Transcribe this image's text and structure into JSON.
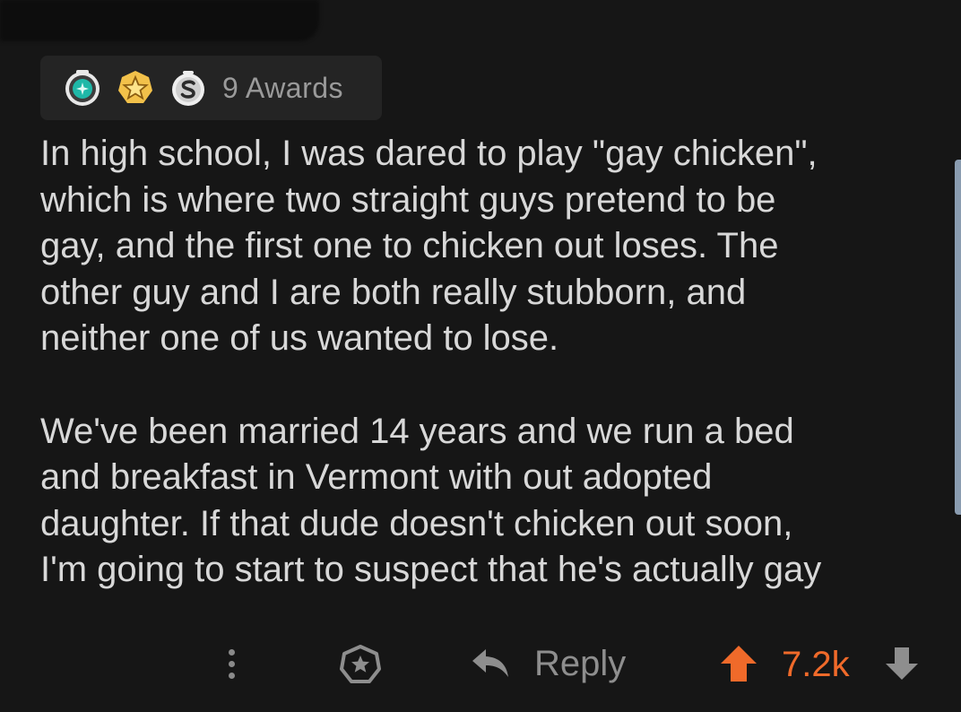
{
  "awards": {
    "icons": [
      "helpful-award-icon",
      "wholesome-star-award-icon",
      "silver-award-icon"
    ],
    "label": "9 Awards"
  },
  "comment": {
    "paragraph_1": "In high school, I was dared to play \"gay chicken\",\nwhich is where two straight guys pretend to be\ngay, and the first one to chicken out loses. The\nother guy and I are both really stubborn, and\nneither one of us wanted to lose.",
    "paragraph_2": "We've been married 14 years and we run a bed\nand breakfast in Vermont with out adopted\ndaughter. If that dude doesn't chicken out soon,\nI'm going to start to suspect that he's actually gay"
  },
  "actions": {
    "more_icon": "more-vertical-icon",
    "award_icon": "give-award-icon",
    "reply_icon": "reply-arrow-icon",
    "reply_label": "Reply",
    "score": "7.2k",
    "upvote_icon": "upvote-arrow-icon",
    "downvote_icon": "downvote-arrow-icon",
    "upvoted": true
  },
  "colors": {
    "background": "#161616",
    "upvote_active": "#f06a2a",
    "text": "#d8d8d8",
    "muted": "#8e8e8e"
  }
}
